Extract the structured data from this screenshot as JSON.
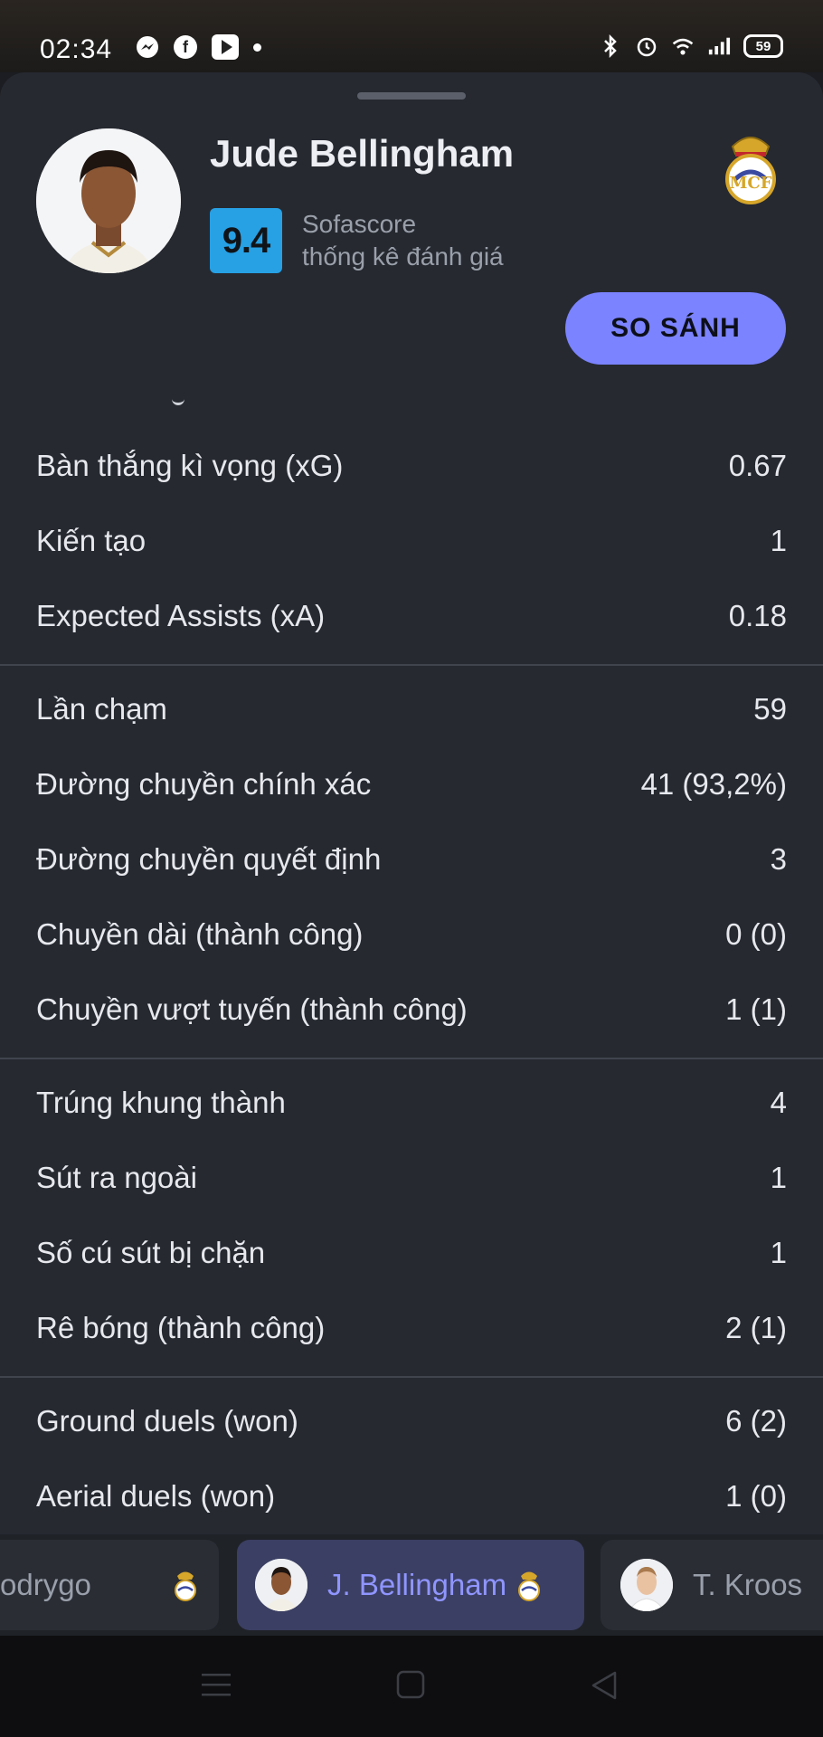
{
  "status_bar": {
    "time": "02:34",
    "battery": "59",
    "icons": [
      "messenger-icon",
      "facebook-icon",
      "youtube-icon",
      "dot-icon",
      "bluetooth-icon",
      "alarm-icon",
      "wifi-icon",
      "signal-icon",
      "battery-icon"
    ]
  },
  "player": {
    "name": "Jude Bellingham",
    "rating": "9.4",
    "rating_source": "Sofascore",
    "rating_caption": "thống kê đánh giá",
    "compare_label": "SO SÁNH"
  },
  "stat_groups": [
    [
      {
        "label": "Bàn thắng kì vọng (xG)",
        "value": "0.67"
      },
      {
        "label": "Kiến tạo",
        "value": "1"
      },
      {
        "label": "Expected Assists (xA)",
        "value": "0.18"
      }
    ],
    [
      {
        "label": "Lần chạm",
        "value": "59"
      },
      {
        "label": "Đường chuyền chính xác",
        "value": "41 (93,2%)"
      },
      {
        "label": "Đường chuyền quyết định",
        "value": "3"
      },
      {
        "label": "Chuyền dài (thành công)",
        "value": "0 (0)"
      },
      {
        "label": "Chuyền vượt tuyến (thành công)",
        "value": "1 (1)"
      }
    ],
    [
      {
        "label": "Trúng khung thành",
        "value": "4"
      },
      {
        "label": "Sút ra ngoài",
        "value": "1"
      },
      {
        "label": "Số cú sút bị chặn",
        "value": "1"
      },
      {
        "label": "Rê bóng (thành công)",
        "value": "2 (1)"
      }
    ],
    [
      {
        "label": "Ground duels (won)",
        "value": "6 (2)"
      },
      {
        "label": "Aerial duels (won)",
        "value": "1 (0)"
      }
    ]
  ],
  "player_tabs": [
    {
      "label": "odrygo",
      "active": false
    },
    {
      "label": "J. Bellingham",
      "active": true
    },
    {
      "label": "T. Kroos",
      "active": false
    }
  ],
  "colors": {
    "sheet_bg": "#262930",
    "rating_bg": "#27a0e4",
    "accent": "#7b83ff",
    "active_tab_bg": "#3b3f63"
  }
}
